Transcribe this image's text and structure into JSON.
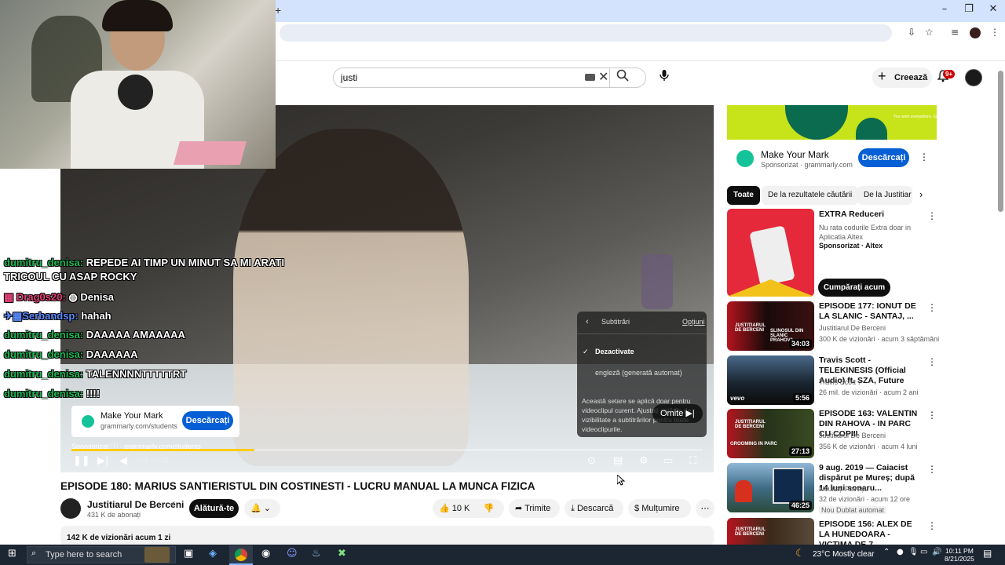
{
  "youtube": {
    "search_value": "justi",
    "create_label": "Creează",
    "notif_badge": "9+"
  },
  "player": {
    "ad": {
      "title": "Make Your Mark",
      "url": "grammarly.com/students",
      "cta": "Descărcați",
      "sponsor": "Sponsorizat",
      "sponsor_url": "grammarly.com/students"
    },
    "time": "0:05 / 0:35",
    "progress": 0.29,
    "subtitles": {
      "header": "Subtitrări",
      "options_link": "Opțiuni",
      "off": "Dezactivate",
      "english": "engleză (generată automat)",
      "note": "Această setare se aplică doar pentru videoclipul curent. Ajustați setările de vizibilitate a subtitrărilor pentru toate videoclipurile."
    },
    "skip_label": "Omite"
  },
  "chat": [
    {
      "user": "dumitru_denisa:",
      "text": "REPEDE AI TIMP UN MINUT SA MI ARATI"
    },
    {
      "user": "",
      "text": "TRICOUL CU ASAP ROCKY"
    },
    {
      "user": "Drag0s20:",
      "text": "Denisa"
    },
    {
      "user": "Serbandsp:",
      "text": "hahah"
    },
    {
      "user": "dumitru_denisa:",
      "text": "DAAAAA AMAAAAA"
    },
    {
      "user": "dumitru_denisa:",
      "text": "DAAAAAA"
    },
    {
      "user": "dumitru_denisa:",
      "text": "TALENNNNTTTTTRT"
    },
    {
      "user": "dumitru_denisa:",
      "text": "!!!!"
    }
  ],
  "video": {
    "title": "EPISODE 180: MARIUS SANTIERISTUL DIN COSTINESTI - LUCRU MANUAL LA MUNCA FIZICA",
    "channel": "Justitiarul De Berceni",
    "subscribers": "431 K de abonați",
    "join": "Alătură-te",
    "likes": "10 K",
    "share": "Trimite",
    "download": "Descarcă",
    "thanks": "Mulțumire",
    "views": "142 K de vizionări  acum 1 zi"
  },
  "sidebar": {
    "ad": {
      "title": "Make Your Mark",
      "sub": "Sponsorizat · grammarly.com",
      "cta": "Descărcați",
      "banner_text": "You work everywhere. So does Grammarly."
    },
    "chips": [
      "Toate",
      "De la rezultatele căutării",
      "De la Justitiar"
    ],
    "promo": {
      "title": "EXTRA Reduceri",
      "desc": "Nu rata codurile Extra doar in Aplicatia Altex",
      "sponsor": "Sponsorizat · Altex",
      "cta": "Cumpărați acum"
    },
    "videos": [
      {
        "title": "EPISODE 177: IONUT DE LA SLANIC - SANTAJ, ...",
        "channel": "Justitiarul De Berceni",
        "meta": "300 K de vizionări · acum 3 săptămâni",
        "duration": "34:03",
        "thumb_text": "SLINOSUL DIN SLANIC PRAHOVA"
      },
      {
        "title": "Travis Scott - TELEKINESIS (Official Audio) ft. SZA, Future",
        "channel": "Travis Scott",
        "meta": "26 mil. de vizionări · acum 2 ani",
        "duration": "5:56",
        "thumb_text": "vevo"
      },
      {
        "title": "EPISODE 163: VALENTIN DIN RAHOVA - IN PARC CU COPIII",
        "channel": "Justitiarul De Berceni",
        "meta": "356 K de vizionări · acum 4 luni",
        "duration": "27:13",
        "thumb_text": "GROOMING IN PARC"
      },
      {
        "title": "9 aug. 2019 — Caiacist dispărut pe Mureș; după 14 luni sonaru...",
        "channel": "Neuitați Povești",
        "meta": "32 de vizionări · acum 12 ore",
        "badges": "Nou   Dublat automat",
        "duration": "46:25"
      },
      {
        "title": "EPISODE 156: ALEX DE LA HUNEDOARA - VICTIMA DE 7 ...",
        "channel": "Justitiarul De Berceni",
        "meta": "",
        "duration": ""
      }
    ]
  },
  "taskbar": {
    "search": "Type here to search",
    "weather": "23°C  Mostly clear",
    "time": "10:11 PM",
    "date": "8/21/2025"
  }
}
